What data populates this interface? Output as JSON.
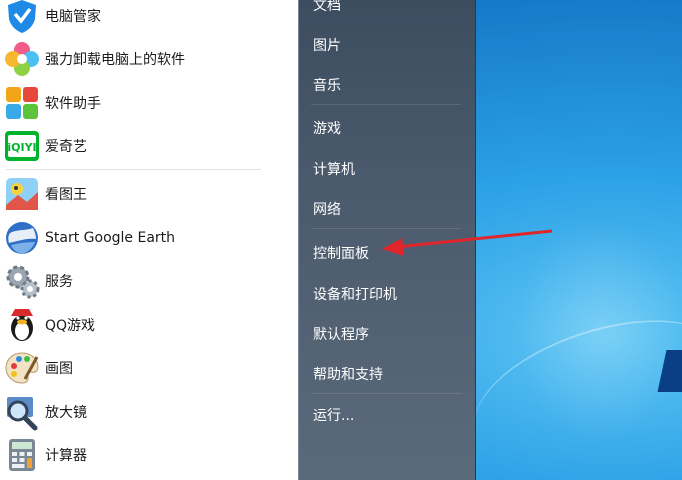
{
  "programs": [
    {
      "label": "电脑管家",
      "icon": "shield-icon"
    },
    {
      "label": "强力卸载电脑上的软件",
      "icon": "uninstall-flower-icon"
    },
    {
      "label": "软件助手",
      "icon": "software-grid-icon"
    },
    {
      "label": "爱奇艺",
      "icon": "iqiyi-icon"
    },
    {
      "label": "看图王",
      "icon": "image-viewer-icon"
    },
    {
      "label": "Start Google Earth",
      "icon": "google-earth-icon"
    },
    {
      "label": "服务",
      "icon": "services-gears-icon"
    },
    {
      "label": "QQ游戏",
      "icon": "qq-penguin-icon"
    },
    {
      "label": "画图",
      "icon": "paint-palette-icon"
    },
    {
      "label": "放大镜",
      "icon": "magnifier-icon"
    },
    {
      "label": "计算器",
      "icon": "calculator-icon"
    }
  ],
  "places": [
    {
      "label": "文档"
    },
    {
      "label": "图片"
    },
    {
      "label": "音乐"
    },
    {
      "label": "游戏"
    },
    {
      "label": "计算机"
    },
    {
      "label": "网络"
    },
    {
      "label": "控制面板"
    },
    {
      "label": "设备和打印机"
    },
    {
      "label": "默认程序"
    },
    {
      "label": "帮助和支持"
    },
    {
      "label": "运行..."
    }
  ],
  "annotation": {
    "color": "#e0262a",
    "target": "控制面板"
  },
  "colors": {
    "panel_dark": "#4b5b6d",
    "desktop": "#1a8fd8"
  }
}
